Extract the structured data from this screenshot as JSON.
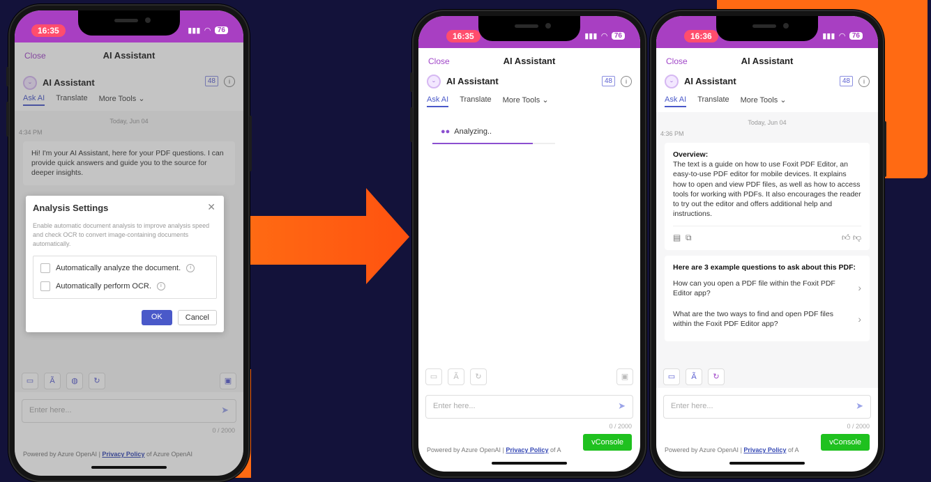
{
  "colors": {
    "background": "#13123a",
    "accent": "#ff6a13",
    "app_header": "#a83fc2",
    "link": "#a046c8",
    "primary": "#4a59c9",
    "vconsole": "#1fc11f"
  },
  "phones": [
    {
      "time": "16:35",
      "battery": "76",
      "nav": {
        "close": "Close",
        "title": "AI Assistant"
      },
      "assistant": {
        "name": "AI Assistant",
        "count": "48",
        "info_icon": "info-icon"
      },
      "tabs": [
        "Ask AI",
        "Translate",
        "More Tools"
      ],
      "chat": {
        "date": "Today, Jun 04",
        "time": "4:34 PM",
        "greeting": "Hi! I'm your AI Assistant, here for your PDF questions. I can provide quick answers and guide you to the source for deeper insights."
      },
      "dialog": {
        "title": "Analysis Settings",
        "description": "Enable automatic document analysis to improve analysis speed and check OCR to convert image-containing documents automatically.",
        "options": [
          "Automatically analyze the document.",
          "Automatically perform OCR."
        ],
        "ok": "OK",
        "cancel": "Cancel"
      },
      "input_placeholder": "Enter here...",
      "char_count": "0 / 2000",
      "footer": {
        "prefix": "Powered by Azure OpenAI | ",
        "privacy": "Privacy Policy",
        "suffix": " of Azure OpenAI"
      }
    },
    {
      "time": "16:35",
      "battery": "76",
      "nav": {
        "close": "Close",
        "title": "AI Assistant"
      },
      "assistant": {
        "name": "AI Assistant",
        "count": "48"
      },
      "tabs": [
        "Ask AI",
        "Translate",
        "More Tools"
      ],
      "analyzing": {
        "text": "Analyzing..",
        "progress": 0.82
      },
      "input_placeholder": "Enter here...",
      "char_count": "0 / 2000",
      "footer": {
        "prefix": "Powered by Azure OpenAI | ",
        "privacy": "Privacy Policy",
        "suffix": " of A"
      },
      "vconsole": "vConsole"
    },
    {
      "time": "16:36",
      "battery": "76",
      "nav": {
        "close": "Close",
        "title": "AI Assistant"
      },
      "assistant": {
        "name": "AI Assistant",
        "count": "48"
      },
      "tabs": [
        "Ask AI",
        "Translate",
        "More Tools"
      ],
      "chat": {
        "date": "Today, Jun 04",
        "time": "4:36 PM"
      },
      "overview": {
        "heading": "Overview:",
        "text": "The text is a guide on how to use Foxit PDF Editor, an easy-to-use PDF editor for mobile devices. It explains how to open and view PDF files, as well as how to access tools for working with PDFs. It also encourages the reader to try out the editor and offers additional help and instructions."
      },
      "questions": {
        "heading": "Here are 3 example questions to ask about this PDF:",
        "items": [
          "How can you open a PDF file within the Foxit PDF Editor app?",
          "What are the two ways to find and open PDF files within the Foxit PDF Editor app?"
        ]
      },
      "input_placeholder": "Enter here...",
      "char_count": "0 / 2000",
      "footer": {
        "prefix": "Powered by Azure OpenAI | ",
        "privacy": "Privacy Policy",
        "suffix": " of A"
      },
      "vconsole": "vConsole"
    }
  ]
}
